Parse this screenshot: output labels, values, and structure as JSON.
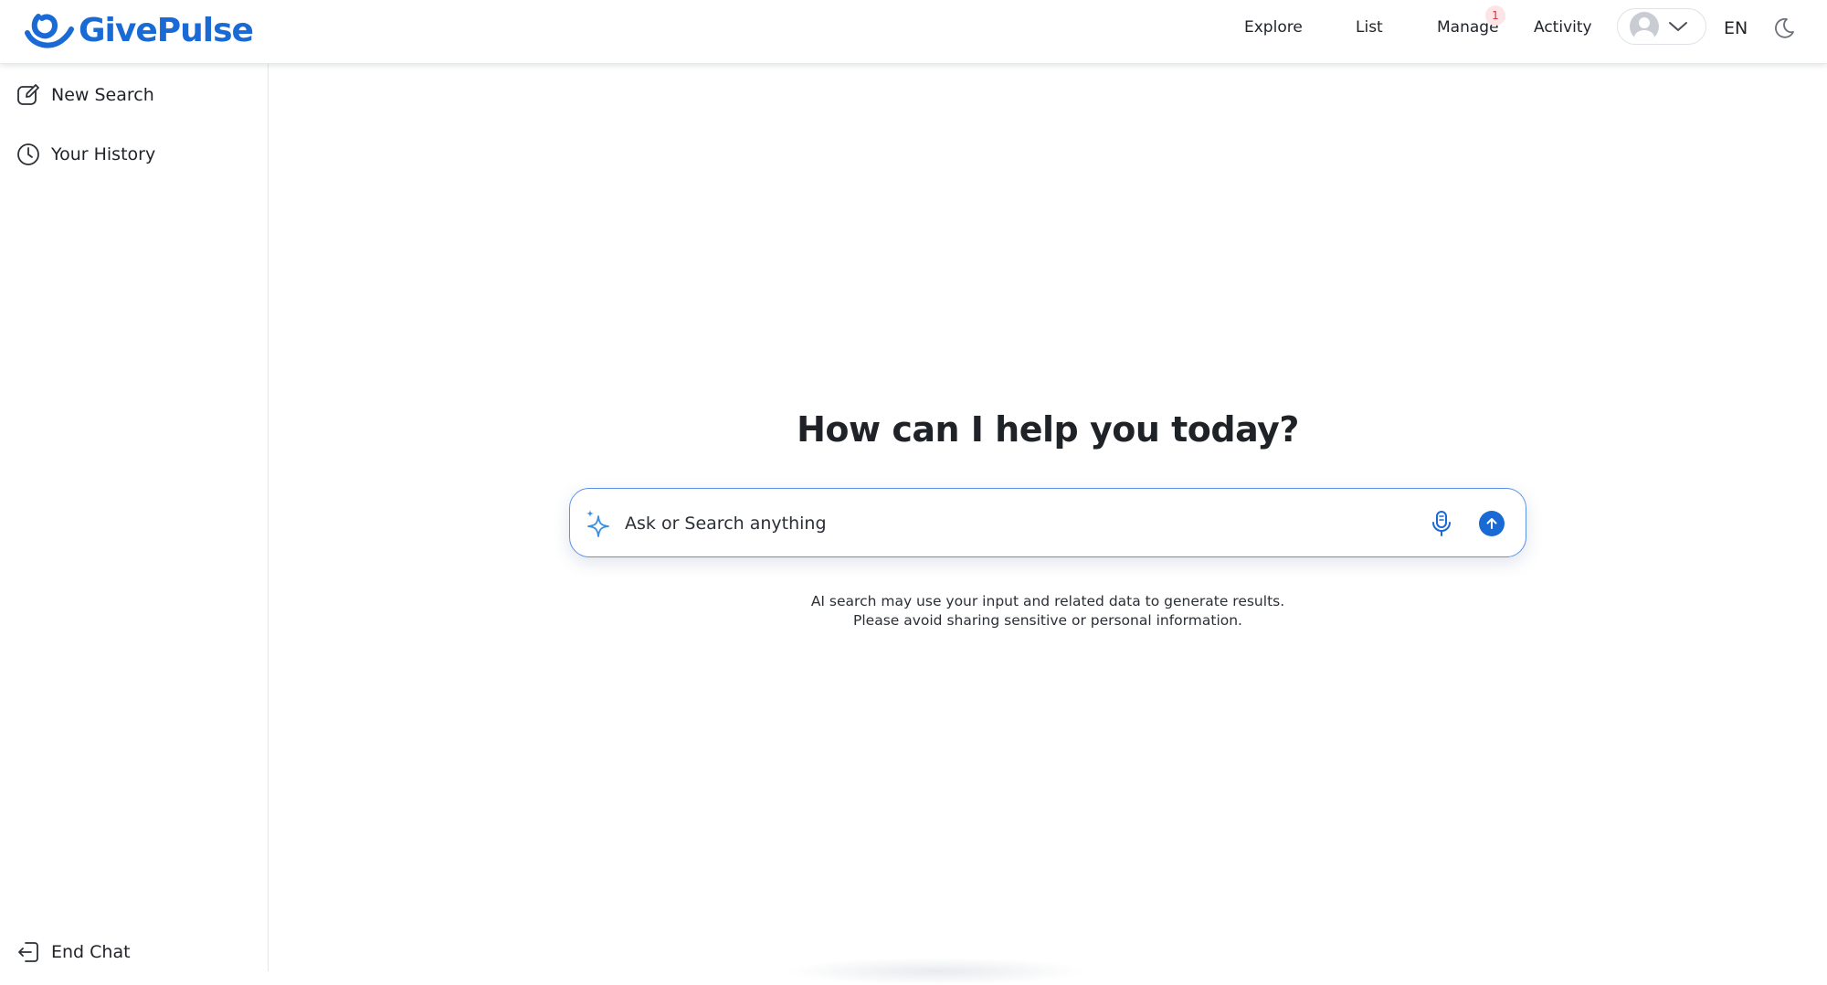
{
  "header": {
    "logo_text": "GivePulse",
    "nav": {
      "explore": "Explore",
      "list": "List",
      "manage": "Manage",
      "activity": "Activity"
    },
    "manage_badge": "1",
    "language": "EN"
  },
  "sidebar": {
    "new_search": "New Search",
    "history": "Your History",
    "end_chat": "End Chat"
  },
  "main": {
    "title": "How can I help you today?",
    "search_placeholder": "Ask or Search anything",
    "disclaimer_line1": "AI search may use your input and related data to generate results.",
    "disclaimer_line2": "Please avoid sharing sensitive or personal information."
  },
  "colors": {
    "brand": "#1a6ad6",
    "badge_bg": "#fde4e6",
    "badge_text": "#d9363e",
    "search_border": "#5b93e6"
  }
}
